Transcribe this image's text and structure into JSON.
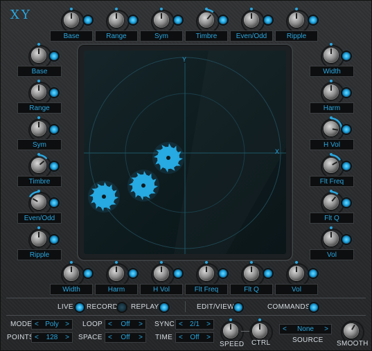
{
  "app": {
    "title": "XY"
  },
  "top_knobs": [
    "Base",
    "Range",
    "Sym",
    "Timbre",
    "Even/Odd",
    "Ripple"
  ],
  "left_knobs": [
    "Base",
    "Range",
    "Sym",
    "Timbre",
    "Even/Odd",
    "Ripple"
  ],
  "right_knobs": [
    "Width",
    "Harm",
    "H Vol",
    "Flt Freq",
    "Flt Q",
    "Vol"
  ],
  "bottom_knobs": [
    "Width",
    "Harm",
    "H Vol",
    "Flt Freq",
    "Flt Q",
    "Vol"
  ],
  "pad": {
    "x_label": "X",
    "y_label": "Y"
  },
  "modes": {
    "live": "LIVE",
    "record": "RECORD",
    "replay": "REPLAY",
    "edit_view": "EDIT/VIEW",
    "commands": "COMMANDS"
  },
  "settings": {
    "mode_label": "MODE",
    "mode_value": "Poly",
    "points_label": "POINTS",
    "points_value": "128",
    "loop_label": "LOOP",
    "loop_value": "Off",
    "space_label": "SPACE",
    "space_value": "Off",
    "sync_label": "SYNC",
    "sync_value": "2/1",
    "time_label": "TIME",
    "time_value": "Off",
    "speed_label": "SPEED",
    "ctrl_label": "CTRL",
    "source_label": "SOURCE",
    "source_value": "None",
    "smooth_label": "SMOOTH",
    "arrow_left": "<",
    "arrow_right": ">"
  },
  "colors": {
    "accent": "#2aa7e0",
    "panel": "#2a2c2e"
  }
}
